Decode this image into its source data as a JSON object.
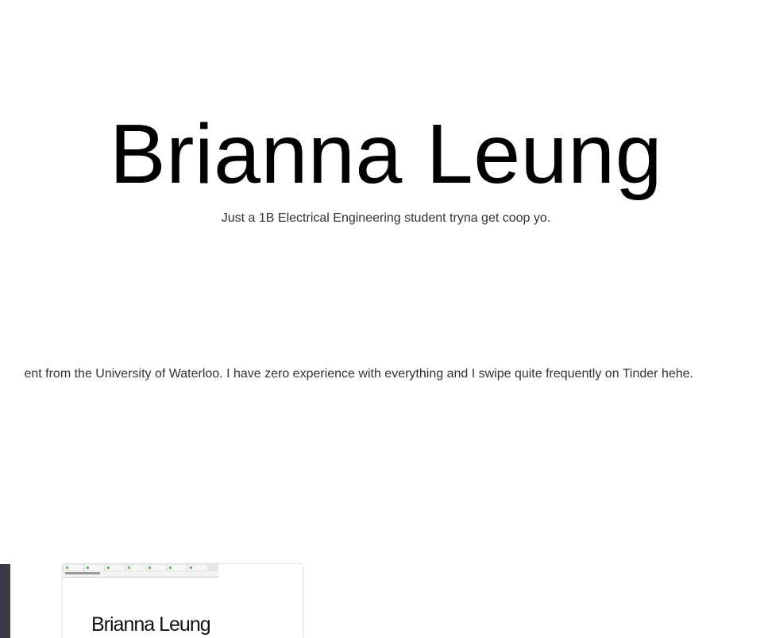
{
  "hero": {
    "name": "Brianna Leung",
    "tagline": "Just a 1B Electrical Engineering student tryna get coop yo."
  },
  "about": {
    "text": "ent from the University of Waterloo. I have zero experience with everything and I swipe quite frequently on Tinder hehe."
  },
  "projects": {
    "thumbnail_title": "Brianna Leung"
  },
  "colors": {
    "background": "#ffffff",
    "title": "#000000",
    "body_text": "#333333",
    "dark_card": "#3b3b45"
  }
}
